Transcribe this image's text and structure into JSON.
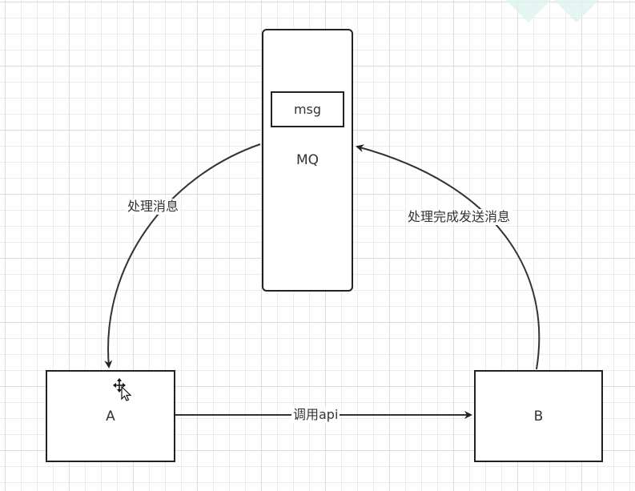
{
  "nodes": {
    "mq": {
      "label": "MQ"
    },
    "msg": {
      "label": "msg"
    },
    "a": {
      "label": "A"
    },
    "b": {
      "label": "B"
    }
  },
  "edges": {
    "mq_to_a": {
      "label": "处理消息"
    },
    "b_to_mq": {
      "label": "处理完成发送消息"
    },
    "a_to_b": {
      "label": "调用api"
    }
  },
  "colors": {
    "stroke": "#222222",
    "grid": "#ebebeb",
    "text": "#333333"
  },
  "icons": {
    "cursor": "move-cursor-icon"
  }
}
